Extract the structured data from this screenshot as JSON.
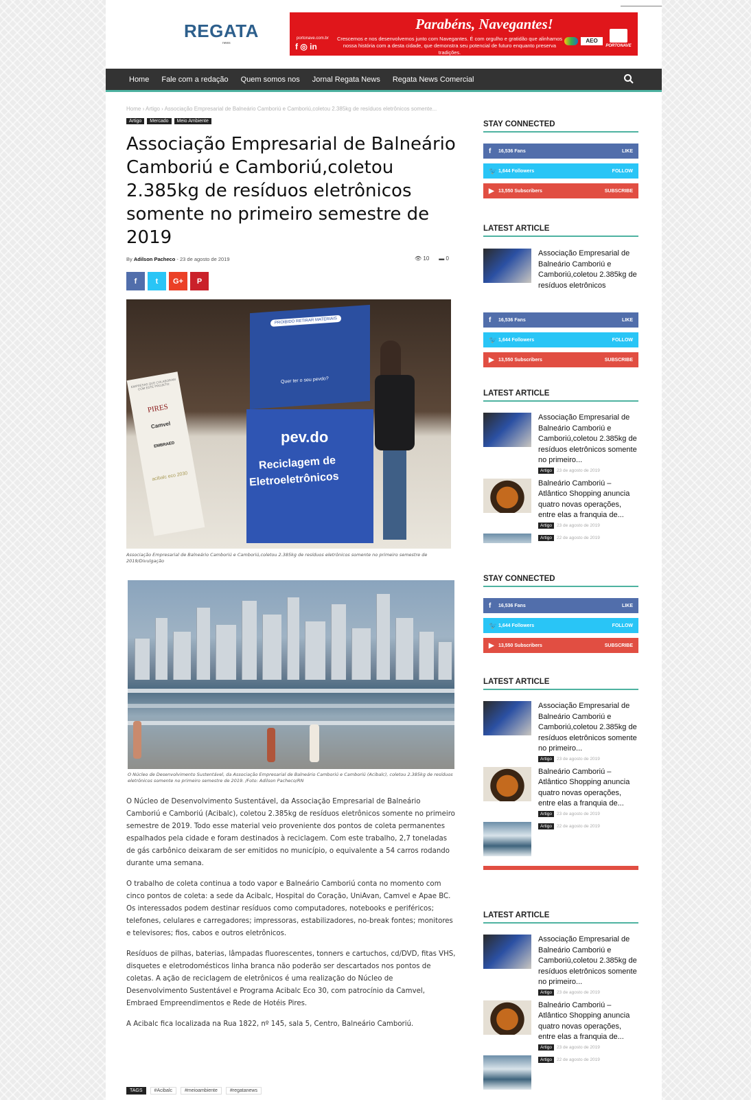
{
  "header": {
    "logo": "REGATA",
    "logo_sub": "news",
    "banner": {
      "title": "Parabéns, Navegantes!",
      "site": "portonave.com.br",
      "text": "Crescemos e nos desenvolvemos junto com Navegantes. É com orgulho e gratidão que alinhamos nossa história com a desta cidade, que demonstra seu potencial de futuro enquanto preserva tradições.",
      "badge": "AEO",
      "brand": "PORTONAVE"
    }
  },
  "nav": {
    "items": [
      "Home",
      "Fale com a redação",
      "Quem somos nos",
      "Jornal Regata News",
      "Regata News Comercial"
    ]
  },
  "breadcrumb": "Home › Artigo › Associação Empresarial de Balneário Camboriú e Camboriú,coletou 2.385kg de resíduos eletrônicos somente...",
  "categories": [
    "Artigo",
    "Mercado",
    "Meio Ambiente"
  ],
  "article": {
    "title": "Associação Empresarial de Balneário Camboriú e Camboriú,coletou 2.385kg de resíduos eletrônicos somente no primeiro semestre de 2019",
    "by": "By",
    "author": "Adilson Pacheco",
    "date": "- 23 de agosto de 2019",
    "views": "10",
    "comments": "0",
    "share": [
      "f",
      "t",
      "G+",
      "P"
    ],
    "img1_caption": "Associação Empresarial de Balneário Camboriú e Camboriú,coletou 2.385kg de resíduos eletrônicos somente no primeiro semestre de 2019/Divulgação",
    "img1_texts": {
      "box_brand": "pev.do",
      "box_line1": "Reciclagem de",
      "box_line2": "Eletroeletrônicos",
      "box_question": "Quer ter o seu pevdo?",
      "box_warning": "PROIBIDO RETIRAR MATERIAIS",
      "banner_head": "EMPRESAS QUE COLABORAM COM ESTE PROJETO:",
      "banner_pires": "PIRES",
      "banner_camvel": "Camvel",
      "banner_embraed": "EMBRAED",
      "banner_eco": "acibalc eco 2030"
    },
    "img2_caption": "O Núcleo de Desenvolvimento Sustentável, da Associação Empresarial de Balneário Camboriú e Camboriú (Acibalc), coletou 2.385kg de resíduos eletrônicos somente no primeiro semestre de 2019. /Foto: Adilson Pacheco/RN",
    "paragraphs": [
      "O Núcleo de Desenvolvimento Sustentável, da Associação Empresarial de Balneário Camboriú e Camboriú (Acibalc), coletou 2.385kg de resíduos eletrônicos somente no primeiro semestre de 2019. Todo esse material veio proveniente dos pontos de coleta permanentes espalhados pela cidade e foram destinados à reciclagem. Com este trabalho, 2,7 toneladas de gás carbônico deixaram de ser emitidos no município, o equivalente a 54 carros rodando durante uma semana.",
      "O trabalho de coleta continua a todo vapor e Balneário Camboriú conta no momento com cinco pontos de coleta: a sede da Acibalc, Hospital do Coração, UniAvan, Camvel e Apae BC. Os interessados podem destinar resíduos como computadores, notebooks e periféricos; telefones, celulares e carregadores; impressoras, estabilizadores, no-break fontes; monitores e televisores; fios, cabos e outros eletrônicos.",
      "Resíduos de pilhas, baterias, lâmpadas fluorescentes, tonners e cartuchos, cd/DVD, fitas VHS, disquetes e eletrodomésticos linha branca não poderão ser descartados nos pontos de coletas. A ação de reciclagem de eletrônicos é uma realização do Núcleo de Desenvolvimento Sustentável e Programa Acibalc Eco 30, com patrocínio da Camvel, Embraed Empreendimentos e Rede de Hotéis Pires.",
      "A Acibalc fica localizada na Rua 1822, nº 145, sala 5, Centro, Balneário Camboriú."
    ],
    "tags_label": "TAGS",
    "tags": [
      "#Acibalc",
      "#meioambiente",
      "#regatanews"
    ]
  },
  "sidebar": {
    "stay_connected": "STAY CONNECTED",
    "latest_article": "LATEST ARTICLE",
    "social": [
      {
        "count": "16,536",
        "unit": "Fans",
        "action": "LIKE"
      },
      {
        "count": "1,644",
        "unit": "Followers",
        "action": "FOLLOW"
      },
      {
        "count": "13,550",
        "unit": "Subscribers",
        "action": "SUBSCRIBE"
      }
    ],
    "latest_short": "Associação Empresarial de Balneário Camboriú e Camboriú,coletou 2.385kg de resíduos eletrônicos",
    "articles": [
      {
        "title": "Associação Empresarial de Balneário Camboriú e Camboriú,coletou 2.385kg de resíduos eletrônicos somente no primeiro...",
        "cat": "Artigo",
        "date": "23 de agosto de 2019"
      },
      {
        "title": "Balneário Camboriú – Atlântico Shopping anuncia quatro novas operações, entre elas a franquia de...",
        "cat": "Artigo",
        "date": "23 de agosto de 2019"
      },
      {
        "title": "",
        "cat": "Artigo",
        "date": "22 de agosto de 2019"
      }
    ]
  },
  "colors": {
    "accent": "#4db2a0",
    "facebook": "#516eab",
    "twitter": "#29c5f6",
    "youtube": "#e14e42",
    "google": "#eb4026",
    "pinterest": "#ca212a"
  }
}
